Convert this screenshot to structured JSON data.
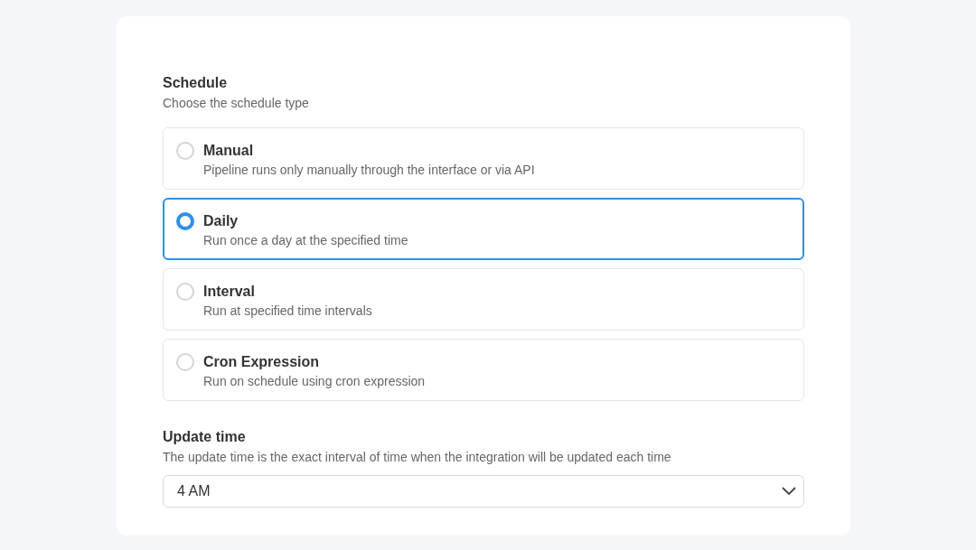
{
  "schedule": {
    "title": "Schedule",
    "subtitle": "Choose the schedule type",
    "options": [
      {
        "label": "Manual",
        "description": "Pipeline runs only manually through the interface or via API",
        "selected": false
      },
      {
        "label": "Daily",
        "description": "Run once a day at the specified time",
        "selected": true
      },
      {
        "label": "Interval",
        "description": "Run at specified time intervals",
        "selected": false
      },
      {
        "label": "Cron Expression",
        "description": "Run on schedule using cron expression",
        "selected": false
      }
    ]
  },
  "update_time": {
    "title": "Update time",
    "description": "The update time is the exact interval of time when the integration will be updated each time",
    "value": "4 AM"
  }
}
